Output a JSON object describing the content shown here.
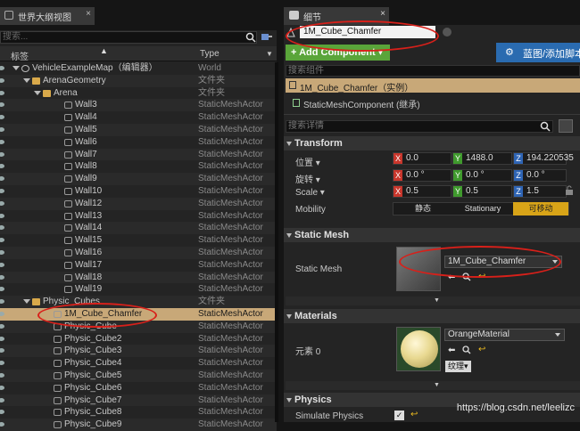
{
  "outliner": {
    "tab_title": "世界大纲视图",
    "search_placeholder": "搜索...",
    "col_label": "标签",
    "col_type": "Type",
    "rows": [
      {
        "name": "VehicleExampleMap（编辑器）",
        "type": "World",
        "icon": "world",
        "indent": 0
      },
      {
        "name": "ArenaGeometry",
        "type": "文件夹",
        "icon": "folder",
        "indent": 1
      },
      {
        "name": "Arena",
        "type": "文件夹",
        "icon": "folder",
        "indent": 2
      },
      {
        "name": "Wall3",
        "type": "StaticMeshActor",
        "icon": "mesh",
        "indent": 3
      },
      {
        "name": "Wall4",
        "type": "StaticMeshActor",
        "icon": "mesh",
        "indent": 3
      },
      {
        "name": "Wall5",
        "type": "StaticMeshActor",
        "icon": "mesh",
        "indent": 3
      },
      {
        "name": "Wall6",
        "type": "StaticMeshActor",
        "icon": "mesh",
        "indent": 3
      },
      {
        "name": "Wall7",
        "type": "StaticMeshActor",
        "icon": "mesh",
        "indent": 3
      },
      {
        "name": "Wall8",
        "type": "StaticMeshActor",
        "icon": "mesh",
        "indent": 3
      },
      {
        "name": "Wall9",
        "type": "StaticMeshActor",
        "icon": "mesh",
        "indent": 3
      },
      {
        "name": "Wall10",
        "type": "StaticMeshActor",
        "icon": "mesh",
        "indent": 3
      },
      {
        "name": "Wall12",
        "type": "StaticMeshActor",
        "icon": "mesh",
        "indent": 3
      },
      {
        "name": "Wall13",
        "type": "StaticMeshActor",
        "icon": "mesh",
        "indent": 3
      },
      {
        "name": "Wall14",
        "type": "StaticMeshActor",
        "icon": "mesh",
        "indent": 3
      },
      {
        "name": "Wall15",
        "type": "StaticMeshActor",
        "icon": "mesh",
        "indent": 3
      },
      {
        "name": "Wall16",
        "type": "StaticMeshActor",
        "icon": "mesh",
        "indent": 3
      },
      {
        "name": "Wall17",
        "type": "StaticMeshActor",
        "icon": "mesh",
        "indent": 3
      },
      {
        "name": "Wall18",
        "type": "StaticMeshActor",
        "icon": "mesh",
        "indent": 3
      },
      {
        "name": "Wall19",
        "type": "StaticMeshActor",
        "icon": "mesh",
        "indent": 3
      },
      {
        "name": "Physic_Cubes",
        "type": "文件夹",
        "icon": "folder",
        "indent": 1
      },
      {
        "name": "1M_Cube_Chamfer",
        "type": "StaticMeshActor",
        "icon": "mesh",
        "indent": 2,
        "selected": true
      },
      {
        "name": "Physic_Cube",
        "type": "StaticMeshActor",
        "icon": "mesh",
        "indent": 2
      },
      {
        "name": "Physic_Cube2",
        "type": "StaticMeshActor",
        "icon": "mesh",
        "indent": 2
      },
      {
        "name": "Physic_Cube3",
        "type": "StaticMeshActor",
        "icon": "mesh",
        "indent": 2
      },
      {
        "name": "Physic_Cube4",
        "type": "StaticMeshActor",
        "icon": "mesh",
        "indent": 2
      },
      {
        "name": "Physic_Cube5",
        "type": "StaticMeshActor",
        "icon": "mesh",
        "indent": 2
      },
      {
        "name": "Physic_Cube6",
        "type": "StaticMeshActor",
        "icon": "mesh",
        "indent": 2
      },
      {
        "name": "Physic_Cube7",
        "type": "StaticMeshActor",
        "icon": "mesh",
        "indent": 2
      },
      {
        "name": "Physic_Cube8",
        "type": "StaticMeshActor",
        "icon": "mesh",
        "indent": 2
      },
      {
        "name": "Physic_Cube9",
        "type": "StaticMeshActor",
        "icon": "mesh",
        "indent": 2
      }
    ]
  },
  "details": {
    "tab_title": "细节",
    "actor_name": "1M_Cube_Chamfer",
    "add_component": "+ Add Component ▾",
    "blueprint_button": "蓝图/添加脚本",
    "search_components_placeholder": "搜索组件",
    "component_root": "1M_Cube_Chamfer（实例）",
    "component_child": "StaticMeshComponent (继承)",
    "search_details_placeholder": "搜索详情",
    "transform": {
      "header": "Transform",
      "location_label": "位置 ▾",
      "location": [
        "0.0",
        "1488.0",
        "194.220535"
      ],
      "rotation_label": "旋转 ▾",
      "rotation": [
        "0.0 °",
        "0.0 °",
        "0.0 °"
      ],
      "scale_label": "Scale ▾",
      "scale": [
        "0.5",
        "0.5",
        "1.5"
      ],
      "mobility_label": "Mobility",
      "mobility_options": [
        "静态",
        "Stationary",
        "可移动"
      ],
      "mobility_selected": "可移动"
    },
    "static_mesh": {
      "header": "Static Mesh",
      "label": "Static Mesh",
      "value": "1M_Cube_Chamfer"
    },
    "materials": {
      "header": "Materials",
      "element_label": "元素 0",
      "value": "OrangeMaterial",
      "texture_button": "纹理▾"
    },
    "physics": {
      "header": "Physics",
      "simulate_label": "Simulate Physics",
      "simulate_checked": true
    }
  },
  "watermark": "https://blog.csdn.net/leelizc",
  "colors": {
    "accent_selected": "#c8a878",
    "add_green": "#5aa53a",
    "blueprint_blue": "#2a6bb0",
    "annotation_red": "#d8201a"
  }
}
